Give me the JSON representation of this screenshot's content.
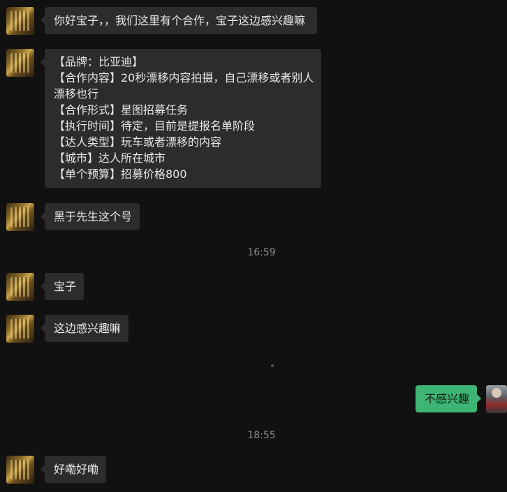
{
  "messages": [
    {
      "text": "你好宝子，，我们这里有个合作，宝子这边感兴趣嘛"
    },
    {
      "lines": [
        "【品牌：比亚迪】",
        "【合作内容】20秒漂移内容拍摄，自己漂移或者别人",
        "漂移也行",
        "【合作形式】星图招募任务",
        "【执行时间】待定，目前是提报名单阶段",
        "【达人类型】玩车或者漂移的内容",
        "【城市】达人所在城市",
        "【单个预算】招募价格800"
      ]
    },
    {
      "text": "黑于先生这个号"
    },
    {
      "text": "宝子"
    },
    {
      "text": "这边感兴趣嘛"
    },
    {
      "text": "不感兴趣"
    },
    {
      "text": "好嘞好嘞"
    }
  ],
  "timestamps": [
    "16:59",
    "18:55"
  ],
  "colors": {
    "background": "#111111",
    "incoming_bubble": "#2c2c2c",
    "outgoing_bubble": "#3eb575"
  }
}
